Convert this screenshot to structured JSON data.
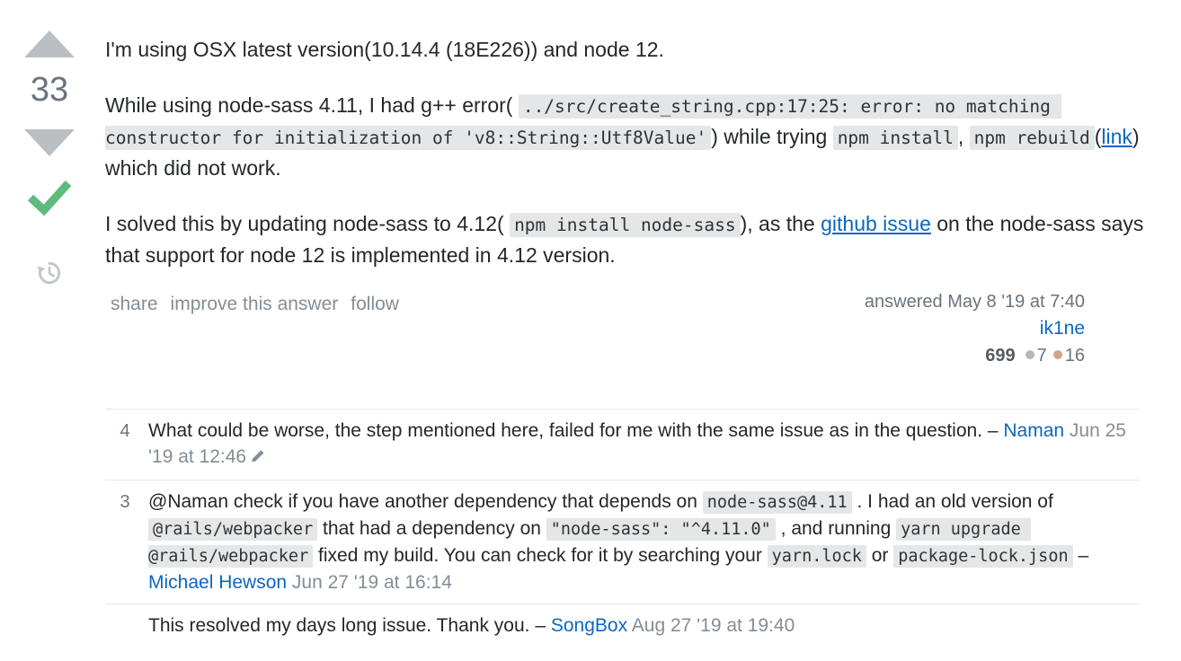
{
  "vote": {
    "up_icon": "triangle-up-icon",
    "down_icon": "triangle-down-icon",
    "count": "33",
    "accepted_icon": "checkmark-icon",
    "history_icon": "history-clock-icon"
  },
  "post": {
    "paragraph1": {
      "text": "I'm using OSX latest version(10.14.4 (18E226)) and node 12."
    },
    "paragraph2": {
      "seg1": "While using node-sass 4.11, I had g++ error(",
      "code1": "../src/create_string.cpp:17:25: error: no matching constructor for initialization of 'v8::String::Utf8Value'",
      "seg2": ") while trying",
      "code2": "npm install",
      "seg3": ",",
      "code3": "npm rebuild",
      "seg4": "(",
      "link_text": "link",
      "seg5": ") which did not work."
    },
    "paragraph3": {
      "seg1": "I solved this by updating node-sass to 4.12(",
      "code1": "npm install node-sass",
      "seg2": "), as the",
      "link_text": "github issue",
      "seg3": "on the node-sass says that support for node 12 is implemented in 4.12 version."
    }
  },
  "post_menu": {
    "share": "share",
    "improve": "improve this answer",
    "follow": "follow"
  },
  "user_card": {
    "action_time": "answered May 8 '19 at 7:40",
    "name": "ik1ne",
    "reputation": "699",
    "silver_badges": "7",
    "bronze_badges": "16"
  },
  "comments": [
    {
      "score": "4",
      "parts": [
        {
          "type": "text",
          "value": "What could be worse, the step mentioned here, failed for me with the same issue as in the question. "
        },
        {
          "type": "dash",
          "value": "– "
        },
        {
          "type": "user",
          "value": "Naman"
        },
        {
          "type": "date",
          "value": " Jun 25 '19 at 12:46"
        },
        {
          "type": "icon",
          "value": "edit-pencil-icon"
        }
      ]
    },
    {
      "score": "3",
      "parts": [
        {
          "type": "text",
          "value": "@Naman check if you have another dependency that depends on "
        },
        {
          "type": "code",
          "value": "node-sass@4.11"
        },
        {
          "type": "text",
          "value": " . I had an old version of "
        },
        {
          "type": "code",
          "value": "@rails/webpacker"
        },
        {
          "type": "text",
          "value": " that had a dependency on "
        },
        {
          "type": "code",
          "value": "\"node-sass\": \"^4.11.0\""
        },
        {
          "type": "text",
          "value": " , and running "
        },
        {
          "type": "code",
          "value": "yarn upgrade @rails/webpacker"
        },
        {
          "type": "text",
          "value": " fixed my build. You can check for it by searching your "
        },
        {
          "type": "code",
          "value": "yarn.lock"
        },
        {
          "type": "text",
          "value": " or "
        },
        {
          "type": "code",
          "value": "package-lock.json"
        },
        {
          "type": "text",
          "value": " "
        },
        {
          "type": "dash",
          "value": "– "
        },
        {
          "type": "user",
          "value": "Michael Hewson"
        },
        {
          "type": "date",
          "value": " Jun 27 '19 at 16:14"
        }
      ]
    },
    {
      "score": "",
      "parts": [
        {
          "type": "text",
          "value": "This resolved my days long issue. Thank you. "
        },
        {
          "type": "dash",
          "value": "– "
        },
        {
          "type": "user",
          "value": "SongBox"
        },
        {
          "type": "date",
          "value": " Aug 27 '19 at 19:40"
        }
      ]
    }
  ],
  "colors": {
    "link": "#0c67bf",
    "accepted_green": "#5eba7d",
    "vote_arrow_gray": "#babfc4",
    "code_bg": "#e4e6e8",
    "muted_text": "#6a737c",
    "silver_badge": "#b4b8bc",
    "bronze_badge": "#d1a684"
  }
}
